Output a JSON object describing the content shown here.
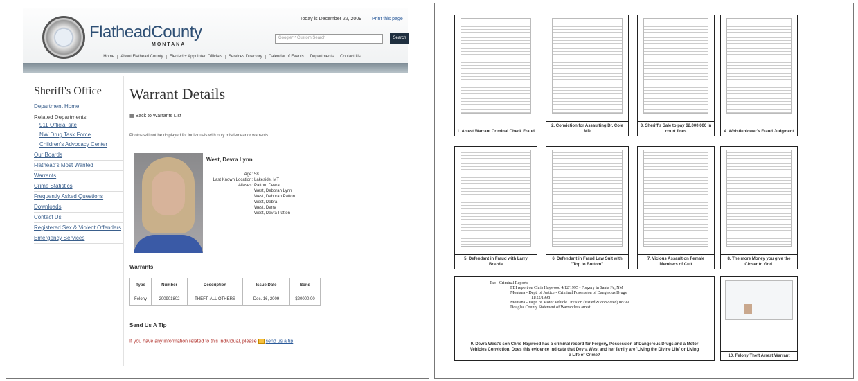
{
  "site": {
    "logo_text": "FlatheadCounty",
    "logo_sub": "MONTANA",
    "today": "Today is December 22, 2009",
    "print_link": "Print this page",
    "search_placeholder": "Google™ Custom Search",
    "search_button": "Search",
    "nav": [
      "Home",
      "About Flathead County",
      "Elected + Appointed Officials",
      "Services Directory",
      "Calendar of Events",
      "Departments",
      "Contact Us"
    ]
  },
  "sidebar": {
    "title": "Sheriff's Office",
    "department_home": "Department Home",
    "related_label": "Related Departments",
    "related": [
      "911 Official site",
      "NW Drug Task Force",
      "Children's Advocacy Center"
    ],
    "items": [
      "Our Boards",
      "Flathead's Most Wanted",
      "Warrants",
      "Crime Statistics",
      "Frequently Asked Questions",
      "Downloads",
      "Contact Us",
      "Registered Sex & Violent Offenders",
      "Emergency Services"
    ]
  },
  "main": {
    "title": "Warrant Details",
    "back_link": "Back to Warrants List",
    "photo_note": "Photos will not be displayed for individuals with only misdemeanor warrants.",
    "person_name": "West, Devra Lynn",
    "age_label": "Age:",
    "age": "58",
    "location_label": "Last Known Location:",
    "location": "Lakeside, MT",
    "aliases_label": "Aliases:",
    "aliases": [
      "Patton, Devra",
      "West, Deborah Lynn",
      "West, Deborah Patton",
      "West, Debra",
      "West, Derra",
      "West, Devra Patton"
    ],
    "warrants_heading": "Warrants",
    "table_headers": [
      "Type",
      "Number",
      "Description",
      "Issue Date",
      "Bond"
    ],
    "table_rows": [
      [
        "Felony",
        "200901802",
        "THEFT, ALL OTHERS",
        "Dec. 16, 2009",
        "$20000.00"
      ]
    ],
    "tip_heading": "Send Us A Tip",
    "tip_text": "If you have any information related to this individual, please",
    "tip_link": "send us a tip"
  },
  "documents": [
    {
      "caption": "1. Arrest Warrant Criminal Check Fraud"
    },
    {
      "caption": "2. Conviction for Assaulting Dr. Cole MD"
    },
    {
      "caption": "3. Sheriff's Sale to pay $2,000,000 in court fines"
    },
    {
      "caption": "4. Whistleblower's Fraud Judgment"
    },
    {
      "caption": "5. Defendant in Fraud with Larry Brazda"
    },
    {
      "caption": "6. Defendant in Fraud Law Suit with \"Top to Bottom\""
    },
    {
      "caption": "7. Vicious Assault on Female Members of Cult"
    },
    {
      "caption": "8. The more Money you give the Closer to God."
    },
    {
      "caption": "9. Devra West's son Chris Haywood has a criminal record for Forgery, Possession of Dangerous Drugs and a Motor Vehicles Conviction. Does this evidence indicate that Devra West and her family are 'Living the Divine Life' or Living a Life of Crime?"
    },
    {
      "caption": "10. Felony Theft Arrest Warrant"
    }
  ],
  "criminal_reports": {
    "lines": [
      "Tab - Criminal Reports",
      "FBI report on Chris Haywood 4/12/1995 - Forgery in Santa Fe, NM",
      "Montana - Dept. of Justice - Criminal Possession of Dangerous Drugs",
      "11/22/1998",
      "Montana - Dept. of Motor Vehicle Division (issued & convicted) 08/99",
      "Douglas County Statement of Warrantless arrest"
    ]
  }
}
